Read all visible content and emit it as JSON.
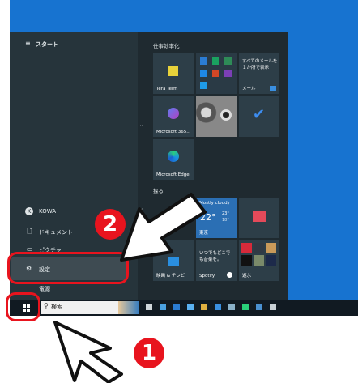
{
  "start_menu": {
    "header": "スタート",
    "user": "KOWA",
    "user_initial": "K",
    "items": [
      {
        "label": "ドキュメント"
      },
      {
        "label": "ピクチャ"
      },
      {
        "label": "設定"
      }
    ],
    "power_partial": "電源"
  },
  "tiles": {
    "group1_title": "仕事効率化",
    "group2_title": "探る",
    "tera_term": "Tera Term",
    "office_text": "すべてのメールを１か所で表示",
    "mail": "メール",
    "m365": "Microsoft 365...",
    "edge": "Microsoft Edge",
    "weather_cond": "Mostly cloudy",
    "weather_temp": "22°",
    "weather_hi": "23°",
    "weather_lo": "18°",
    "weather_city": "東京",
    "tv_text": "いつでもどこでも音楽を。",
    "movies": "映画 & テレビ",
    "spotify": "Spotify",
    "play": "遊ぶ"
  },
  "taskbar": {
    "search_placeholder": "検索"
  },
  "callouts": {
    "step1": "1",
    "step2": "2",
    "color": "#e8141e"
  }
}
